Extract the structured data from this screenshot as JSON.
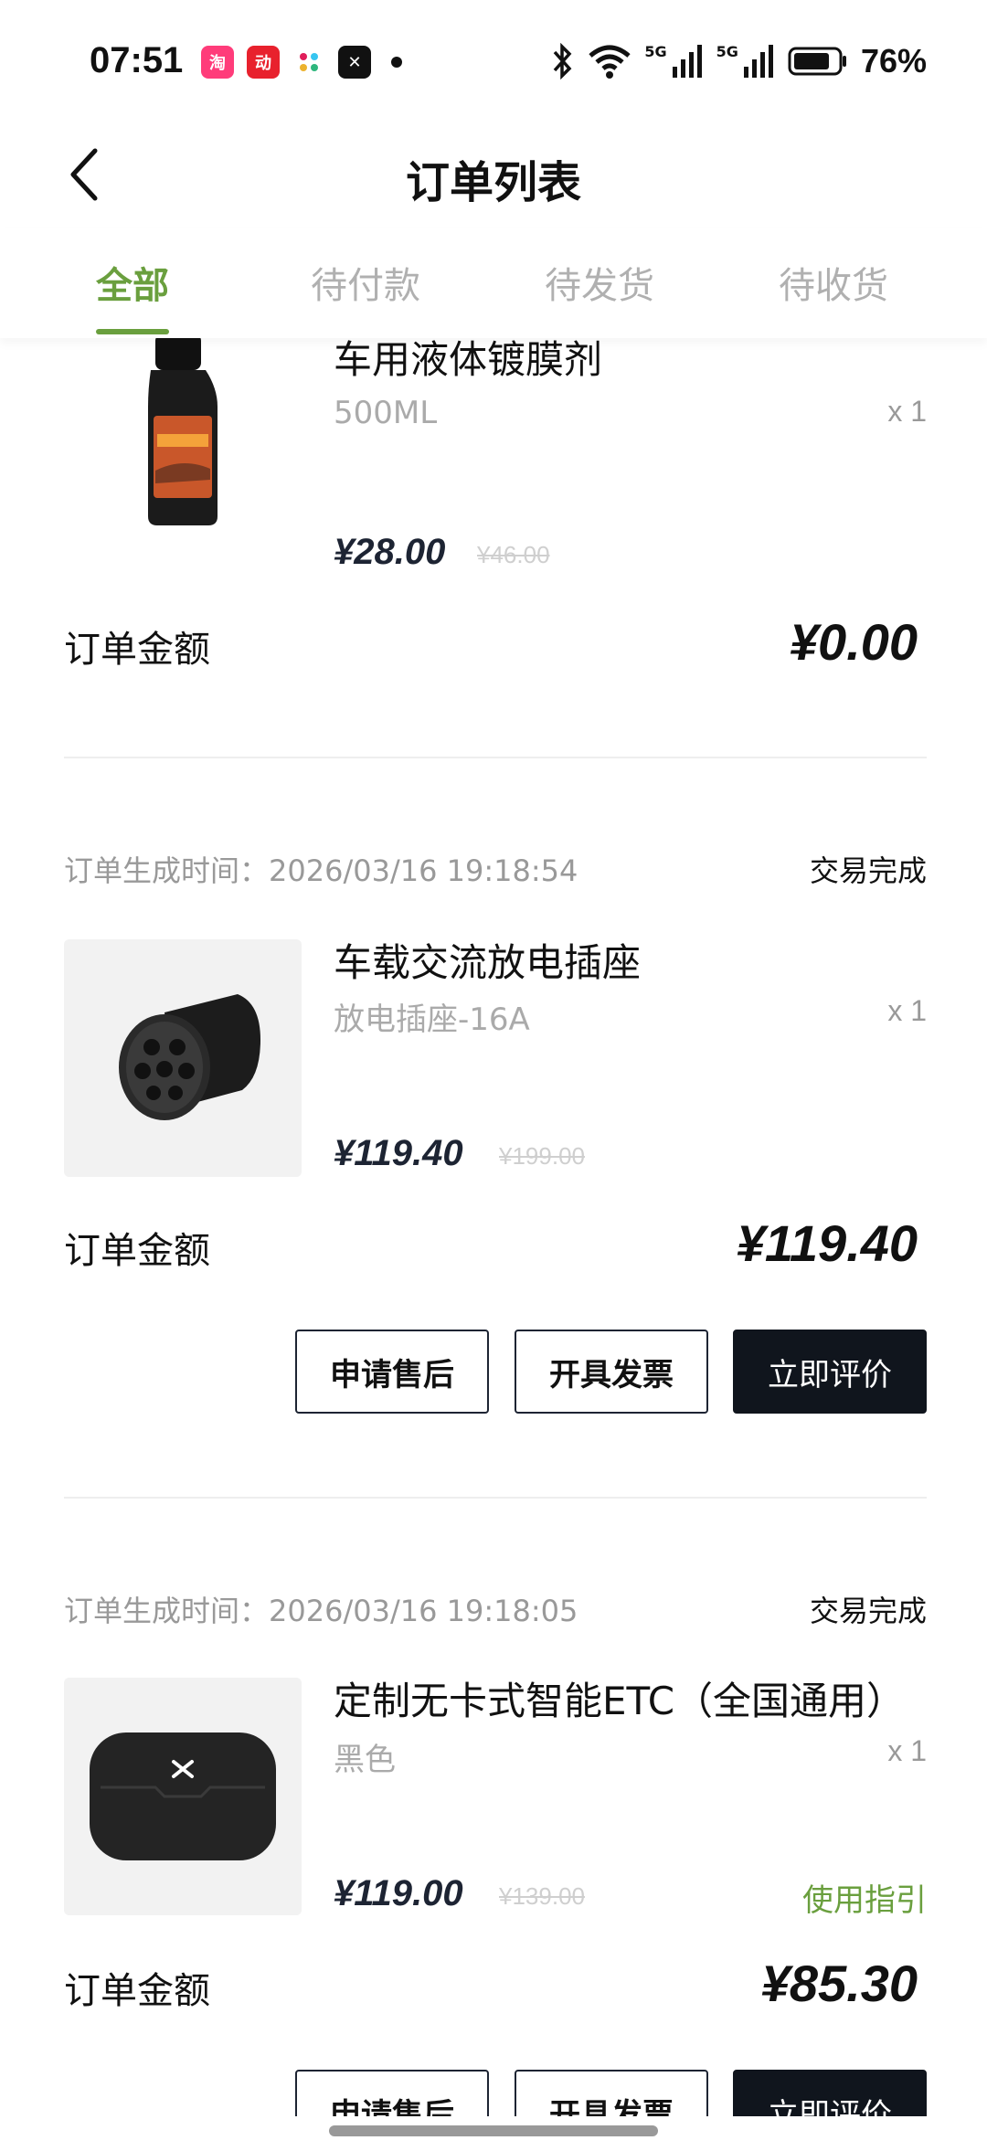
{
  "status_bar": {
    "time": "07:51",
    "battery": "76%",
    "network_badge": "5G",
    "apps": [
      {
        "name": "taobao-icon",
        "glyph": "淘",
        "color": "#ff3c7a"
      },
      {
        "name": "dongche-icon",
        "glyph": "动",
        "color": "#e8212d"
      },
      {
        "name": "slack-icon",
        "glyph": "✣",
        "color": "#ffffff"
      },
      {
        "name": "xpeng-icon",
        "glyph": "✕",
        "color": "#111111"
      }
    ]
  },
  "header": {
    "title": "订单列表"
  },
  "tabs": [
    {
      "label": "全部",
      "active": true
    },
    {
      "label": "待付款",
      "active": false
    },
    {
      "label": "待发货",
      "active": false
    },
    {
      "label": "待收货",
      "active": false
    }
  ],
  "orders": [
    {
      "product": {
        "name": "车用液体镀膜剂",
        "spec": "500ML",
        "qty": "x 1",
        "price": "¥28.00",
        "original_price": "¥46.00"
      },
      "amount_label": "订单金额",
      "amount": "¥0.00"
    },
    {
      "time_label": "订单生成时间：2026/03/16 19:18:54",
      "status": "交易完成",
      "product": {
        "name": "车载交流放电插座",
        "spec": "放电插座-16A",
        "qty": "x 1",
        "price": "¥119.40",
        "original_price": "¥199.00"
      },
      "amount_label": "订单金额",
      "amount": "¥119.40",
      "buttons": [
        "申请售后",
        "开具发票",
        "立即评价"
      ]
    },
    {
      "time_label": "订单生成时间：2026/03/16 19:18:05",
      "status": "交易完成",
      "product": {
        "name": "定制无卡式智能ETC（全国通用）",
        "spec": "黑色",
        "qty": "x 1",
        "price": "¥119.00",
        "original_price": "¥139.00",
        "link": "使用指引"
      },
      "amount_label": "订单金额",
      "amount": "¥85.30",
      "buttons": [
        "申请售后",
        "开具发票",
        "立即评价"
      ]
    }
  ],
  "colors": {
    "accent": "#6a9f3e",
    "dark_button": "#10151d",
    "price": "#1d2433"
  }
}
